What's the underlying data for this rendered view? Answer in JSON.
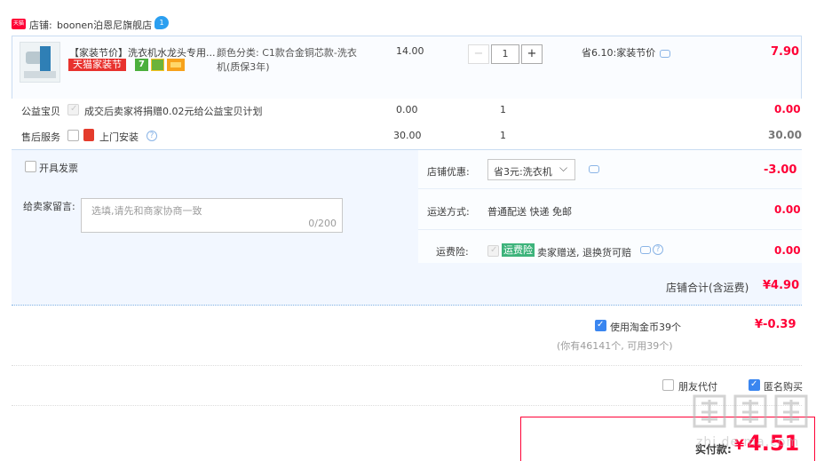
{
  "shop": {
    "label": "店铺:",
    "name": "boonen泊恩尼旗舰店",
    "badge": "1",
    "tmall_icon_text": "天猫"
  },
  "item": {
    "title": "【家装节价】洗衣机水龙头专用...",
    "festival_tag": "天猫家装节",
    "tag_7": "7",
    "sku_line1": "颜色分类:  C1款合金铜芯款-洗衣",
    "sku_line2": "机(质保3年)",
    "unit_price": "14.00",
    "quantity": "1",
    "minus": "−",
    "plus": "+",
    "discount": "省6.10:家装节价",
    "subtotal": "7.90"
  },
  "charity": {
    "label": "公益宝贝",
    "text": "成交后卖家将捐赠0.02元给公益宝贝计划",
    "price": "0.00",
    "qty": "1",
    "amount": "0.00"
  },
  "aftersale": {
    "label": "售后服务",
    "text": "上门安装",
    "price": "30.00",
    "qty": "1",
    "amount": "30.00"
  },
  "invoice": {
    "label": "开具发票"
  },
  "message": {
    "label": "给卖家留言:",
    "placeholder": "选填,请先和商家协商一致",
    "counter": "0/200"
  },
  "shop_discount": {
    "label": "店铺优惠:",
    "value": "省3元:洗衣机",
    "amount": "-3.00"
  },
  "shipping": {
    "label": "运送方式:",
    "value": "普通配送 快递 免邮",
    "amount": "0.00"
  },
  "shipping_insurance": {
    "label": "运费险:",
    "badge": "运费险",
    "text": "卖家赠送, 退换货可赔",
    "amount": "0.00"
  },
  "shop_total": {
    "label": "店铺合计(含运费)",
    "amount": "¥4.90"
  },
  "coins": {
    "label": "使用淘金币39个",
    "note": "(你有46141个, 可用39个)",
    "amount": "¥-0.39"
  },
  "options": {
    "friend_pay": "朋友代付",
    "anonymous": "匿名购买"
  },
  "payment": {
    "label": "实付款:",
    "currency": "¥",
    "amount": "4.51"
  },
  "watermark": "值 值 值 zhi.de ma.com"
}
